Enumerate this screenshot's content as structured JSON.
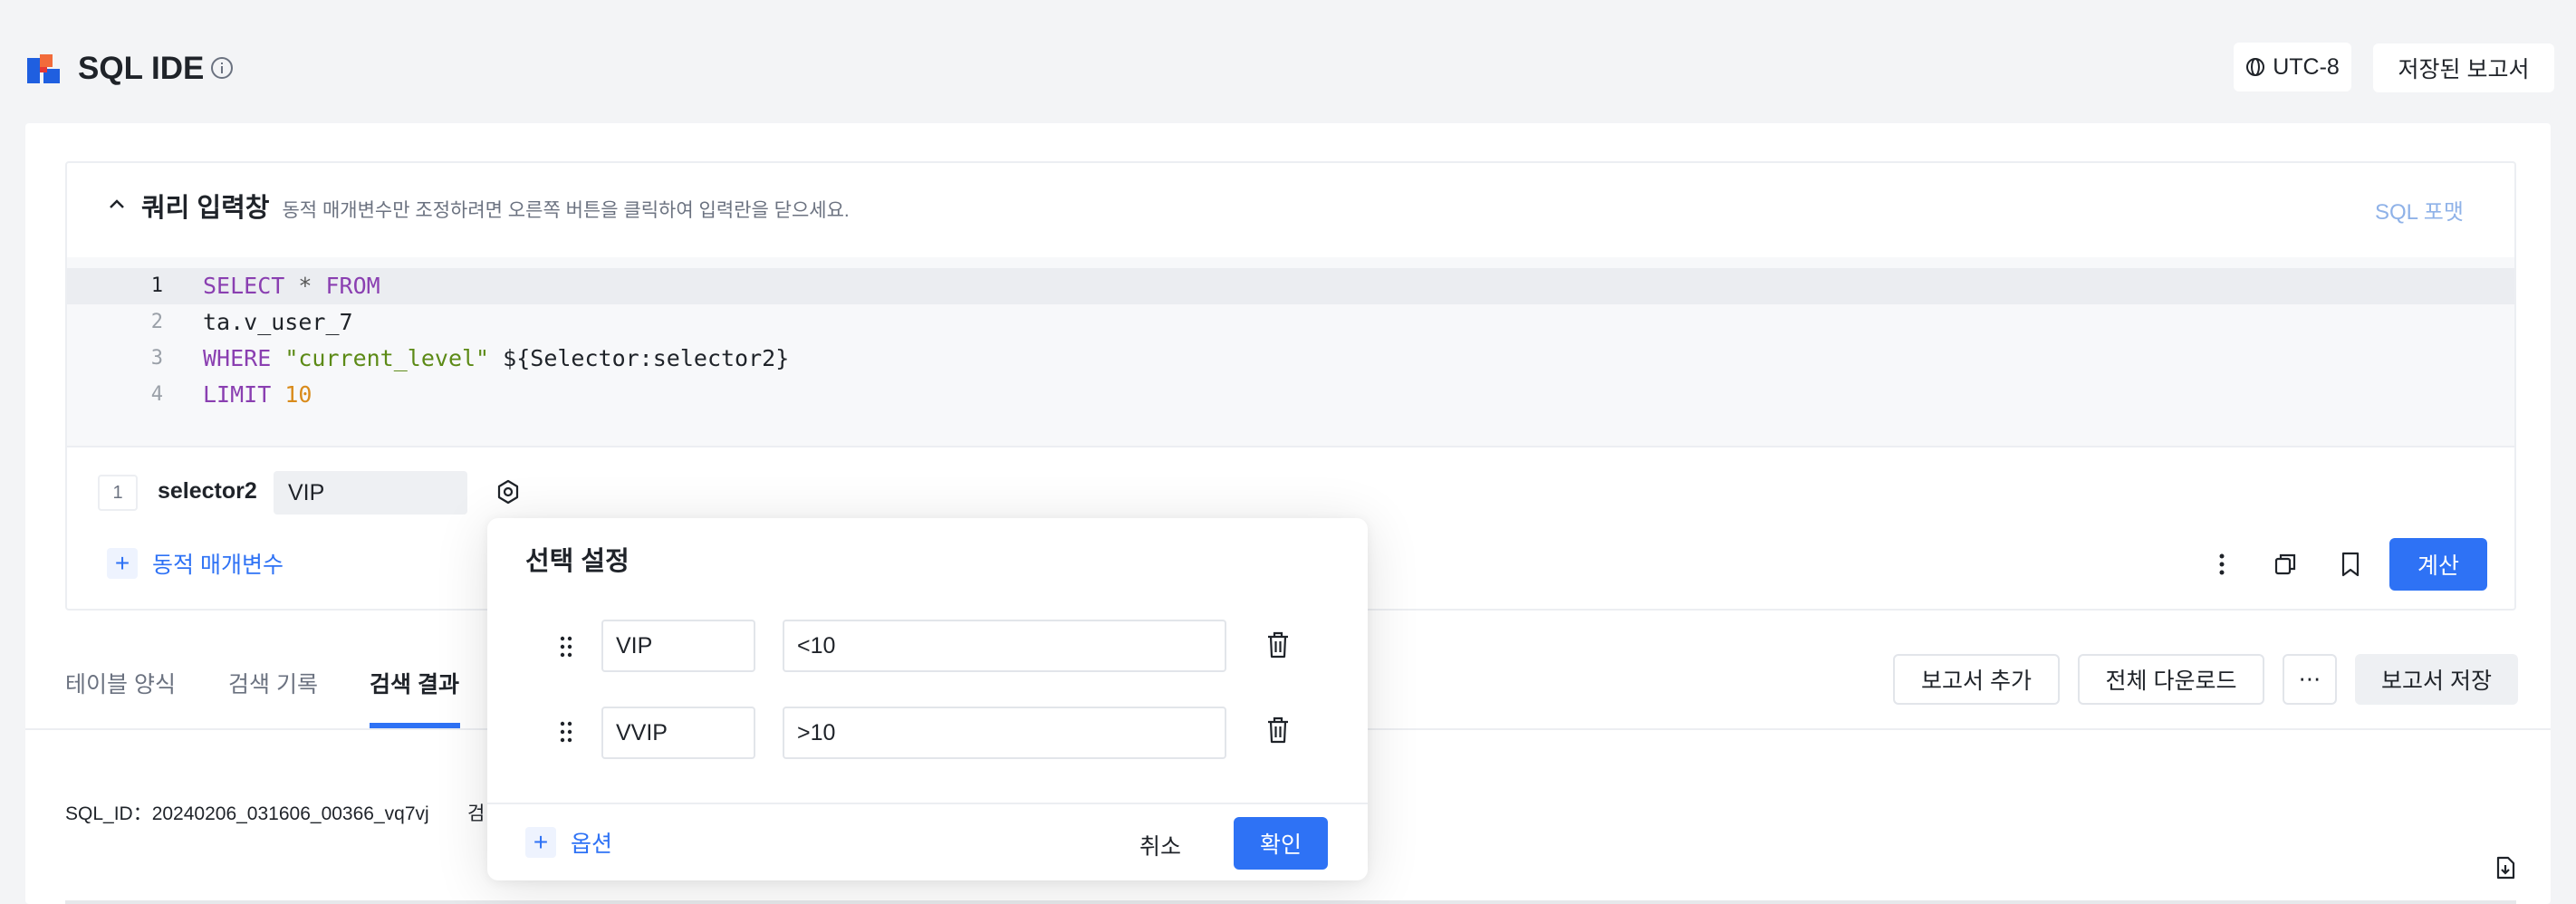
{
  "header": {
    "title": "SQL IDE",
    "timezone": "UTC-8",
    "saved_reports": "저장된 보고서",
    "icons": {
      "logo": "brand-logo",
      "info": "info-icon",
      "globe": "globe-icon"
    }
  },
  "query_panel": {
    "title": "쿼리 입력창",
    "hint": "동적 매개변수만 조정하려면 오른쪽 버튼을 클릭하여 입력란을 닫으세요.",
    "sql_format": "SQL 포맷",
    "line_numbers": [
      "1",
      "2",
      "3",
      "4"
    ],
    "code": {
      "l1_kw1": "SELECT",
      "l1_op": " * ",
      "l1_kw2": "FROM",
      "l2": "ta.v_user_7",
      "l3_kw": "WHERE",
      "l3_str": "\"current_level\"",
      "l3_rest": "${Selector:selector2}",
      "l4_kw": "LIMIT",
      "l4_num": "10"
    }
  },
  "parameter": {
    "index": "1",
    "name": "selector2",
    "value": "VIP",
    "add_label": "동적 매개변수"
  },
  "toolbar": {
    "calculate": "계산"
  },
  "tabs": [
    {
      "label": "테이블 양식"
    },
    {
      "label": "검색 기록"
    },
    {
      "label": "검색 결과"
    }
  ],
  "actions": {
    "add_report": "보고서 추가",
    "download_all": "전체 다운로드",
    "more": "⋯",
    "save_report": "보고서 저장"
  },
  "result": {
    "sql_id": "SQL_ID：20240206_031606_00366_vq7vj",
    "partial": "검"
  },
  "popup": {
    "title": "선택 설정",
    "options": [
      {
        "label": "VIP",
        "value": "<10"
      },
      {
        "label": "VVIP",
        "value": ">10"
      }
    ],
    "add_option": "옵션",
    "cancel": "취소",
    "confirm": "확인"
  },
  "colors": {
    "accent": "#2e72f5",
    "keyword": "#8a3fb1",
    "string": "#5c8a16",
    "number": "#d98b1b"
  }
}
